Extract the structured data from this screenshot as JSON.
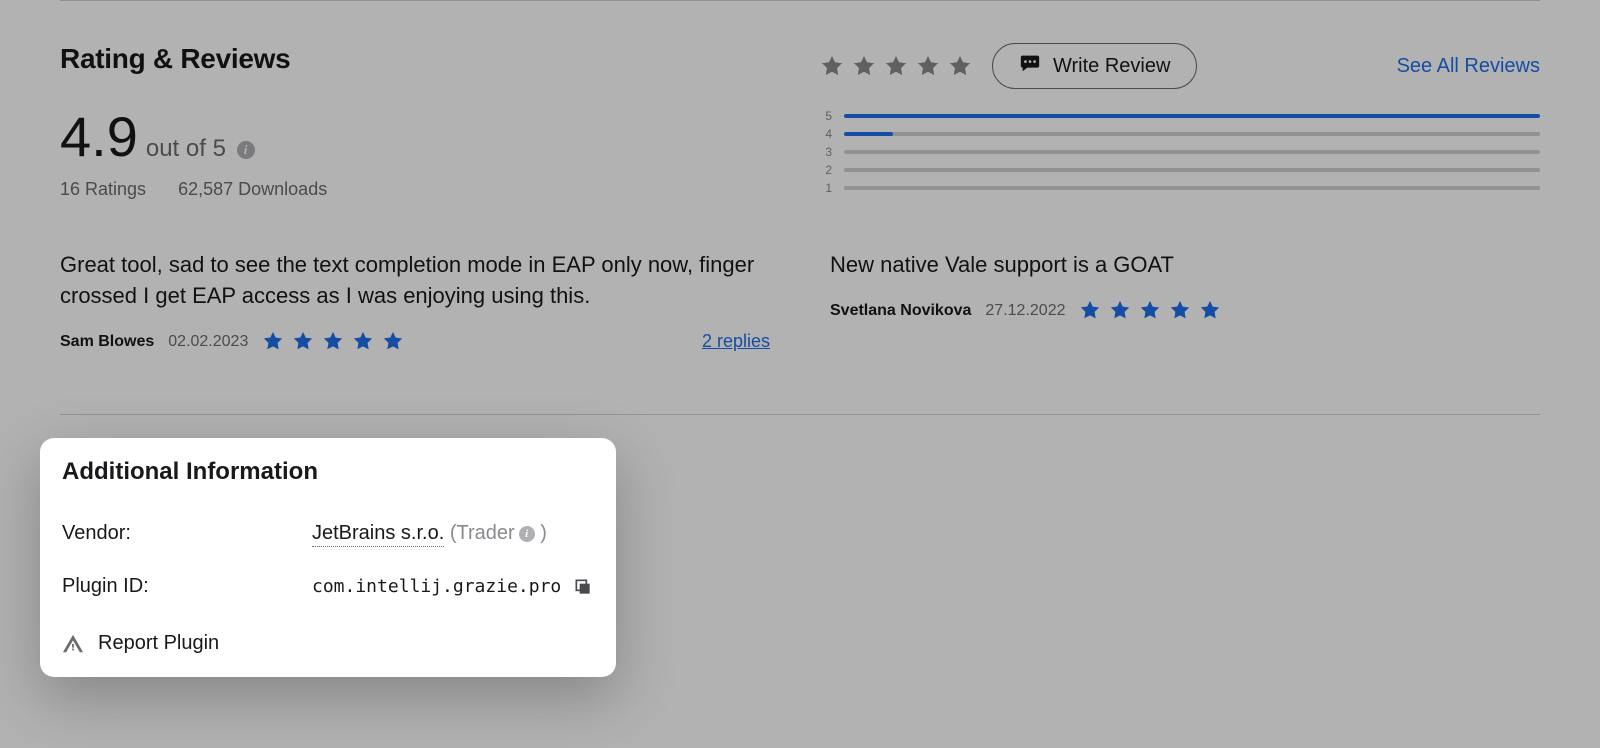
{
  "ratings": {
    "title": "Rating & Reviews",
    "score": "4.9",
    "score_suffix": "out of 5",
    "ratings_count": "16 Ratings",
    "downloads": "62,587 Downloads",
    "write_review": "Write Review",
    "see_all": "See All Reviews",
    "dist": [
      "5",
      "4",
      "3",
      "2",
      "1"
    ],
    "dist_fill": [
      100,
      7,
      0,
      0,
      0
    ]
  },
  "reviews": [
    {
      "text": "Great tool, sad to see the text completion mode in EAP only now, finger crossed I get EAP access as I was enjoying using this.",
      "author": "Sam Blowes",
      "date": "02.02.2023",
      "stars": 5,
      "replies": "2 replies"
    },
    {
      "text": "New native Vale support is a GOAT",
      "author": "Svetlana Novikova",
      "date": "27.12.2022",
      "stars": 5,
      "replies": ""
    }
  ],
  "popover": {
    "title": "Additional Information",
    "vendor_label": "Vendor:",
    "vendor_name": "JetBrains s.r.o.",
    "trader_prefix": " (Trader",
    "trader_suffix": " )",
    "plugin_id_label": "Plugin ID:",
    "plugin_id": "com.intellij.grazie.pro",
    "report": "Report Plugin"
  },
  "colors": {
    "blue": "#1f6feb",
    "gray": "#6c6c70"
  }
}
